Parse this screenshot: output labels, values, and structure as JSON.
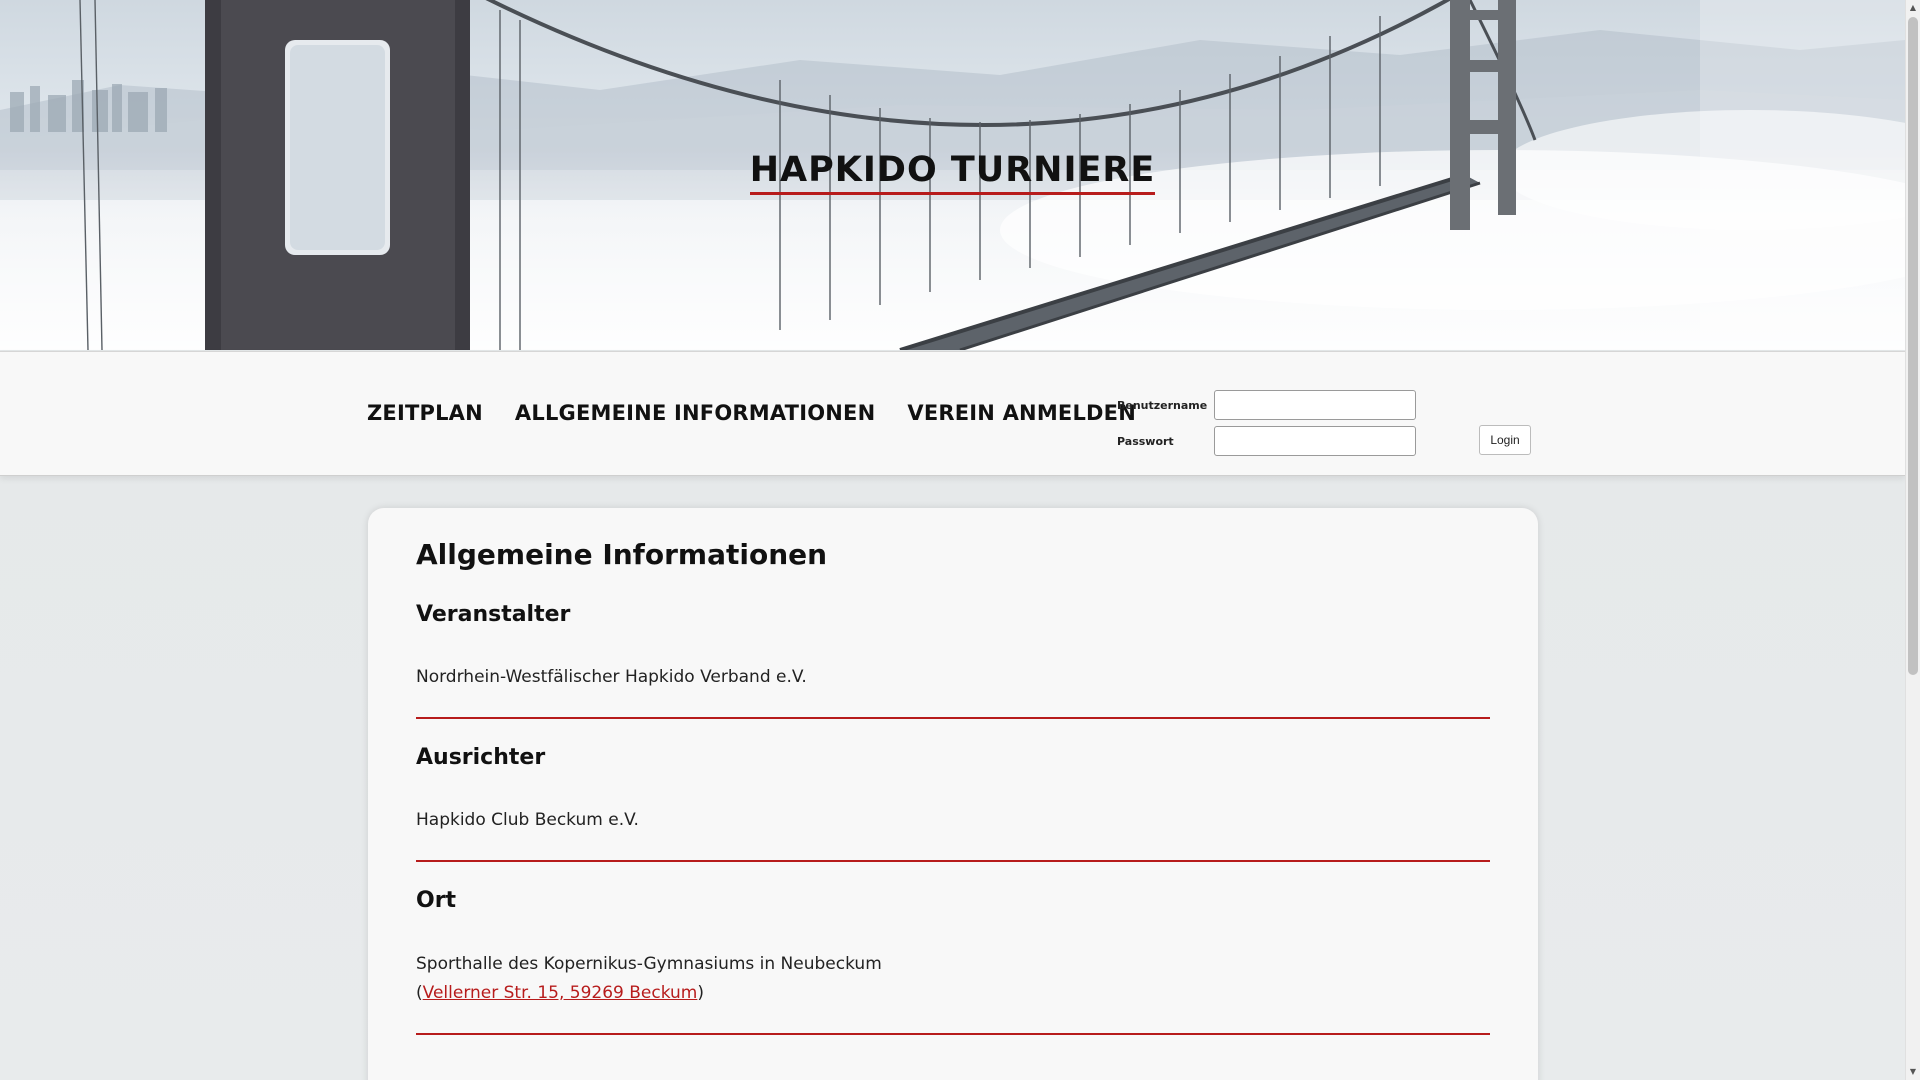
{
  "header": {
    "site_title": "HAPKIDO TURNIERE"
  },
  "nav": {
    "items": [
      {
        "label": "ZEITPLAN"
      },
      {
        "label": "ALLGEMEINE INFORMATIONEN"
      },
      {
        "label": "VEREIN ANMELDEN"
      }
    ]
  },
  "login": {
    "username_label": "Benutzername",
    "username_value": "",
    "password_label": "Passwort",
    "password_value": "",
    "button_label": "Login"
  },
  "content": {
    "page_title": "Allgemeine Informationen",
    "sections": [
      {
        "heading": "Veranstalter",
        "text": "Nordrhein-Westfälischer Hapkido Verband e.V."
      },
      {
        "heading": "Ausrichter",
        "text": "Hapkido Club Beckum e.V."
      },
      {
        "heading": "Ort",
        "text": "Sporthalle des Kopernikus-Gymnasiums in Neubeckum",
        "link_prefix": "(",
        "link_text": "Vellerner Str. 15, 59269 Beckum",
        "link_suffix": ")"
      }
    ]
  },
  "colors": {
    "accent": "#b71c1c",
    "nav_background": "#f8f8f8",
    "card_background": "#f8f8f8"
  },
  "scrollbar": {
    "up_icon": "triangle-up-icon",
    "down_icon": "triangle-down-icon"
  }
}
